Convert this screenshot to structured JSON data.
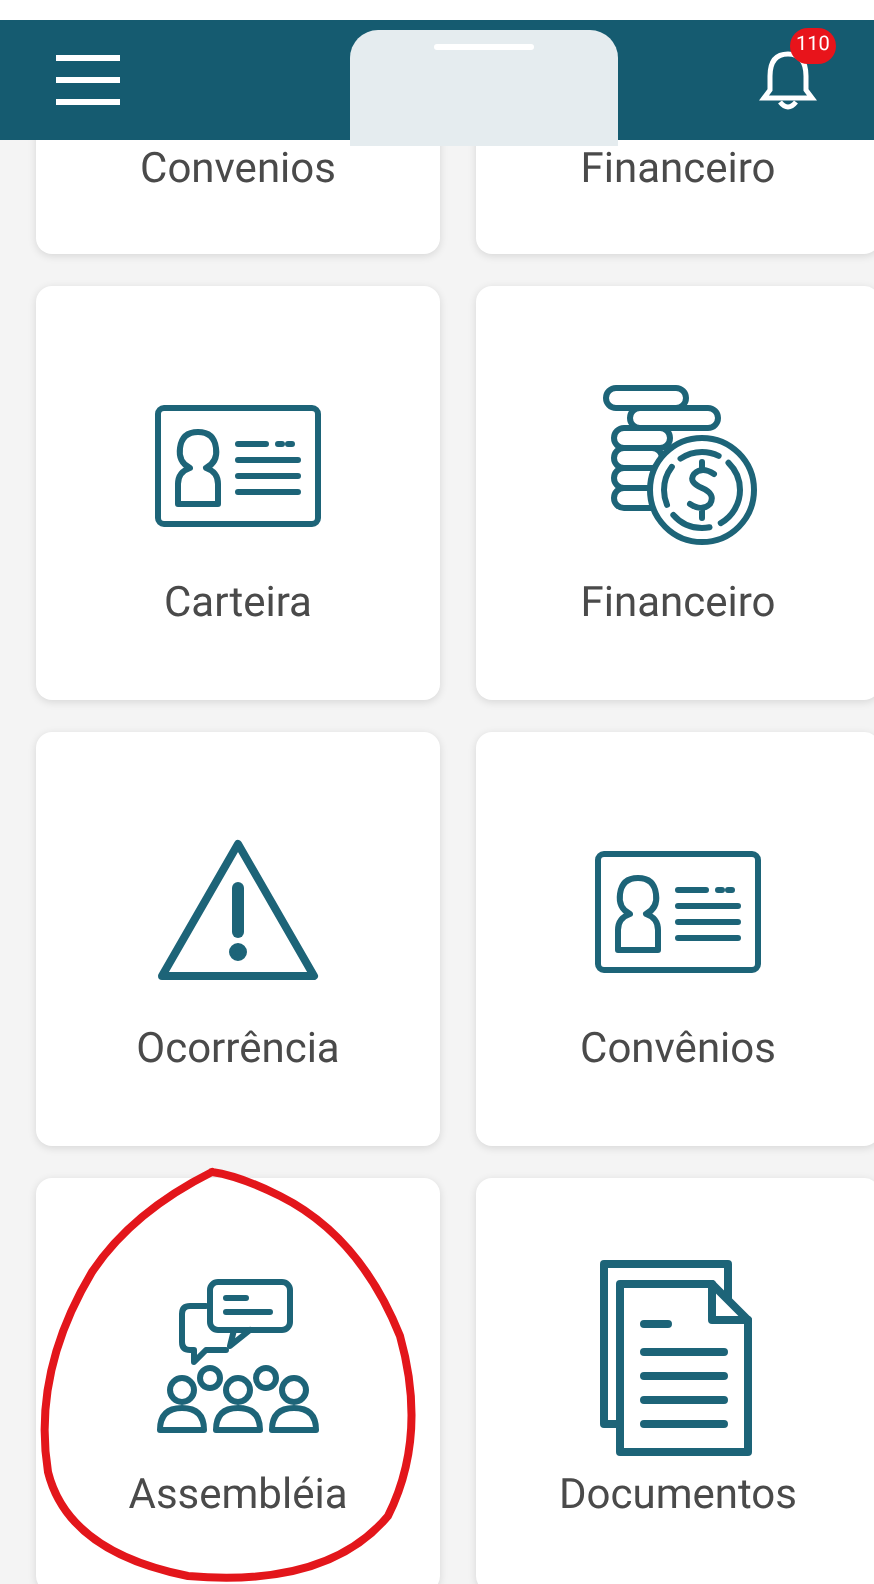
{
  "header": {
    "notification_count": "110"
  },
  "top_row": [
    {
      "label": "Convenios"
    },
    {
      "label": "Financeiro"
    }
  ],
  "cards": [
    {
      "label": "Carteira",
      "kind": "idcard"
    },
    {
      "label": "Financeiro",
      "kind": "coins"
    },
    {
      "label": "Ocorrência",
      "kind": "warning"
    },
    {
      "label": "Convênios",
      "kind": "idcard"
    },
    {
      "label": "Assembléia",
      "kind": "people"
    },
    {
      "label": "Documentos",
      "kind": "documents"
    }
  ]
}
